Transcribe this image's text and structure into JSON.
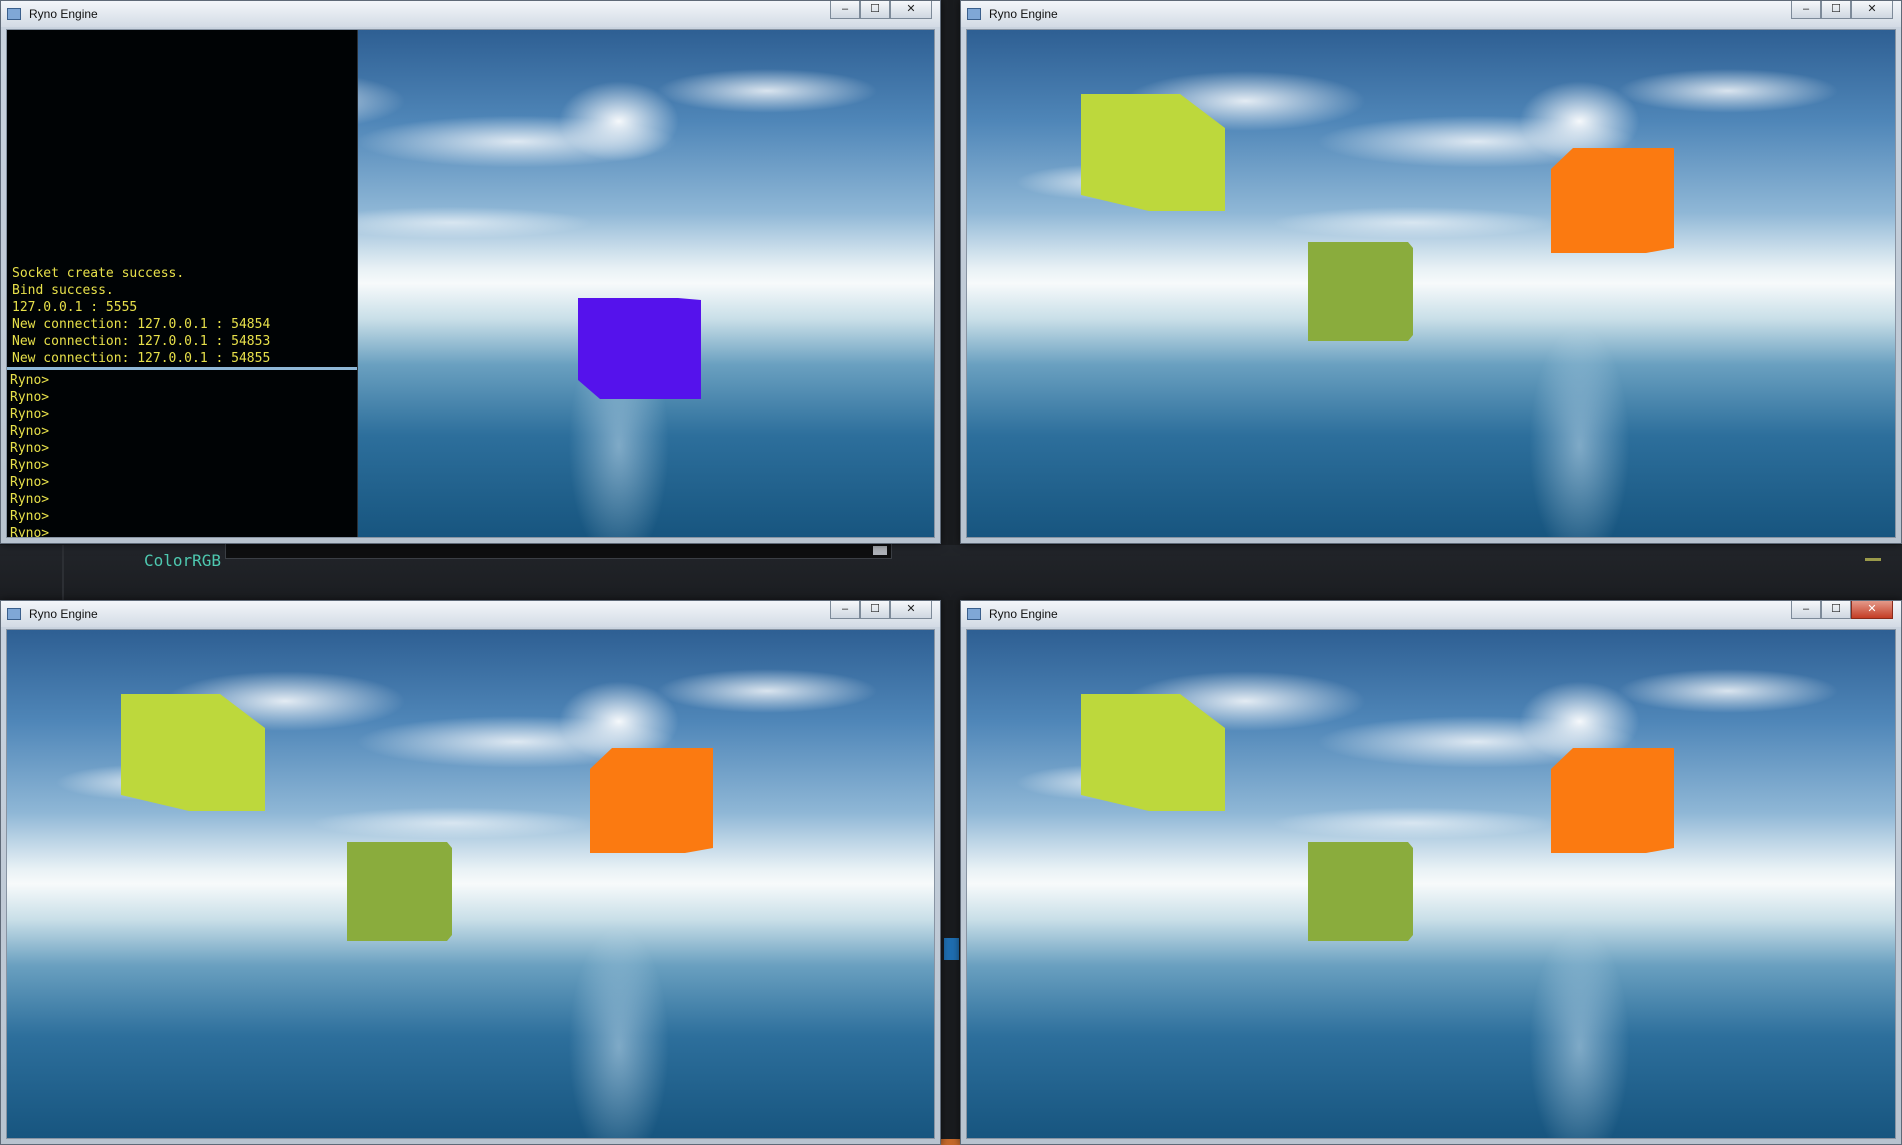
{
  "background_ide": {
    "code_fragment": "ColorRGB"
  },
  "windows": [
    {
      "id": "top-left",
      "title": "Ryno Engine",
      "controls": {
        "minimize": "–",
        "maximize": "☐",
        "close": "✕"
      },
      "console": {
        "log": [
          "Socket create success.",
          "Bind success.",
          "127.0.0.1 : 5555",
          "New connection: 127.0.0.1 : 54854",
          "New connection: 127.0.0.1 : 54853",
          "New connection: 127.0.0.1 : 54855"
        ],
        "prompts": [
          "Ryno>",
          "Ryno>",
          "Ryno>",
          "Ryno>",
          "Ryno>",
          "Ryno>",
          "Ryno>",
          "Ryno>",
          "Ryno>",
          "Ryno>"
        ]
      },
      "cubes": [
        {
          "name": "purple-cube",
          "color": "#5512ec"
        }
      ]
    },
    {
      "id": "top-right",
      "title": "Ryno Engine",
      "controls": {
        "minimize": "–",
        "maximize": "☐",
        "close": "✕"
      },
      "cubes": [
        {
          "name": "lime-cube",
          "color": "#bdd83c"
        },
        {
          "name": "orange-cube",
          "color": "#fb7a11"
        },
        {
          "name": "green-cube",
          "color": "#8aac3d"
        }
      ]
    },
    {
      "id": "bottom-left",
      "title": "Ryno Engine",
      "controls": {
        "minimize": "–",
        "maximize": "☐",
        "close": "✕"
      },
      "cubes": [
        {
          "name": "lime-cube",
          "color": "#bdd83c"
        },
        {
          "name": "orange-cube",
          "color": "#fb7a11"
        },
        {
          "name": "green-cube",
          "color": "#8aac3d"
        }
      ]
    },
    {
      "id": "bottom-right",
      "title": "Ryno Engine",
      "controls": {
        "minimize": "–",
        "maximize": "☐",
        "close": "✕"
      },
      "cubes": [
        {
          "name": "lime-cube",
          "color": "#bdd83c"
        },
        {
          "name": "orange-cube",
          "color": "#fb7a11"
        },
        {
          "name": "green-cube",
          "color": "#8aac3d"
        }
      ]
    }
  ]
}
